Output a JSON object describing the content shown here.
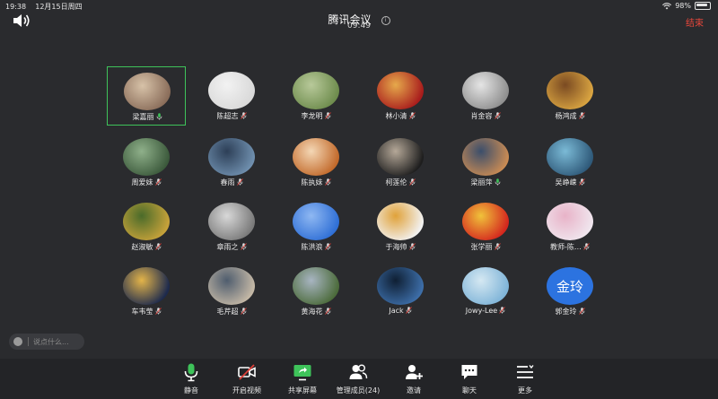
{
  "status_bar": {
    "time": "19:38",
    "date": "12月15日周四",
    "battery": "98%"
  },
  "header": {
    "title": "腾讯会议",
    "timer": "09:49",
    "end_label": "结束"
  },
  "participants": [
    {
      "name": "梁嘉丽",
      "mic": "on",
      "active": true,
      "avatar": [
        "#8a6d5a",
        "#d7c2a8"
      ]
    },
    {
      "name": "陈超志",
      "mic": "muted",
      "active": false,
      "avatar": [
        "#d9d9d9",
        "#f2f2f2"
      ]
    },
    {
      "name": "李龙明",
      "mic": "muted",
      "active": false,
      "avatar": [
        "#6e8c4d",
        "#b8c99a"
      ]
    },
    {
      "name": "林小清",
      "mic": "muted",
      "active": false,
      "avatar": [
        "#a81c1c",
        "#e6a94b"
      ]
    },
    {
      "name": "肖金容",
      "mic": "muted",
      "active": false,
      "avatar": [
        "#8f8f8f",
        "#e5e5e5"
      ]
    },
    {
      "name": "杨鸿成",
      "mic": "muted",
      "active": false,
      "avatar": [
        "#d9a441",
        "#7a4a22"
      ]
    },
    {
      "name": "周爱妹",
      "mic": "muted",
      "active": false,
      "avatar": [
        "#3c5a3c",
        "#8fb08a"
      ]
    },
    {
      "name": "春雨",
      "mic": "muted",
      "active": false,
      "avatar": [
        "#6f8fae",
        "#2d3f57"
      ]
    },
    {
      "name": "陈执妹",
      "mic": "muted",
      "active": false,
      "avatar": [
        "#c26a2b",
        "#f4d7b5"
      ]
    },
    {
      "name": "柯莲伦",
      "mic": "muted",
      "active": false,
      "avatar": [
        "#1e1e1e",
        "#b5a898"
      ]
    },
    {
      "name": "梁丽萍",
      "mic": "on",
      "active": false,
      "avatar": [
        "#c98b54",
        "#3b4e6b"
      ]
    },
    {
      "name": "吴峥嵘",
      "mic": "muted",
      "active": false,
      "avatar": [
        "#2f5a7a",
        "#7bbad6"
      ]
    },
    {
      "name": "赵淑敏",
      "mic": "muted",
      "active": false,
      "avatar": [
        "#c7a23a",
        "#4a6b2a"
      ]
    },
    {
      "name": "章雨之",
      "mic": "muted",
      "active": false,
      "avatar": [
        "#7a7a7a",
        "#d8d8d8"
      ]
    },
    {
      "name": "陈洪浪",
      "mic": "muted",
      "active": false,
      "avatar": [
        "#2f6fd6",
        "#8fb8f2"
      ]
    },
    {
      "name": "于海帅",
      "mic": "muted",
      "active": false,
      "avatar": [
        "#f2f2f2",
        "#e0a23a"
      ]
    },
    {
      "name": "张学丽",
      "mic": "muted",
      "active": false,
      "avatar": [
        "#d4261e",
        "#f0c23a"
      ]
    },
    {
      "name": "教师-陈…",
      "mic": "muted",
      "active": false,
      "avatar": [
        "#f0e6ee",
        "#e8b3c8"
      ]
    },
    {
      "name": "车韦莹",
      "mic": "muted",
      "active": false,
      "avatar": [
        "#1d2a4d",
        "#e3b44a"
      ]
    },
    {
      "name": "毛芹超",
      "mic": "muted",
      "active": false,
      "avatar": [
        "#c4b8a6",
        "#4f5d6e"
      ]
    },
    {
      "name": "黄海花",
      "mic": "muted",
      "active": false,
      "avatar": [
        "#4c6b3b",
        "#a8b5c2"
      ]
    },
    {
      "name": "Jack",
      "mic": "muted",
      "active": false,
      "avatar": [
        "#3d6ea8",
        "#0f1f33"
      ]
    },
    {
      "name": "Jowy-Lee",
      "mic": "muted",
      "active": false,
      "avatar": [
        "#7fb4d8",
        "#d5e8f2"
      ]
    },
    {
      "name": "郭金玲",
      "mic": "muted",
      "active": false,
      "avatar_text": "金玲",
      "avatar": [
        "#2c73e0",
        "#2c73e0"
      ]
    }
  ],
  "chat": {
    "placeholder": "说点什么..."
  },
  "toolbar": {
    "items": [
      {
        "id": "mute",
        "label": "静音",
        "icon": "microphone-icon"
      },
      {
        "id": "video",
        "label": "开启视频",
        "icon": "video-off-icon"
      },
      {
        "id": "share",
        "label": "共享屏幕",
        "icon": "share-screen-icon"
      },
      {
        "id": "members",
        "label": "管理成员(24)",
        "icon": "members-icon"
      },
      {
        "id": "invite",
        "label": "邀请",
        "icon": "invite-icon"
      },
      {
        "id": "chat",
        "label": "聊天",
        "icon": "chat-icon"
      },
      {
        "id": "more",
        "label": "更多",
        "icon": "more-icon"
      }
    ]
  },
  "colors": {
    "accent_green": "#3ec35a",
    "end_red": "#e8473b",
    "mic_red": "#e0413a"
  }
}
